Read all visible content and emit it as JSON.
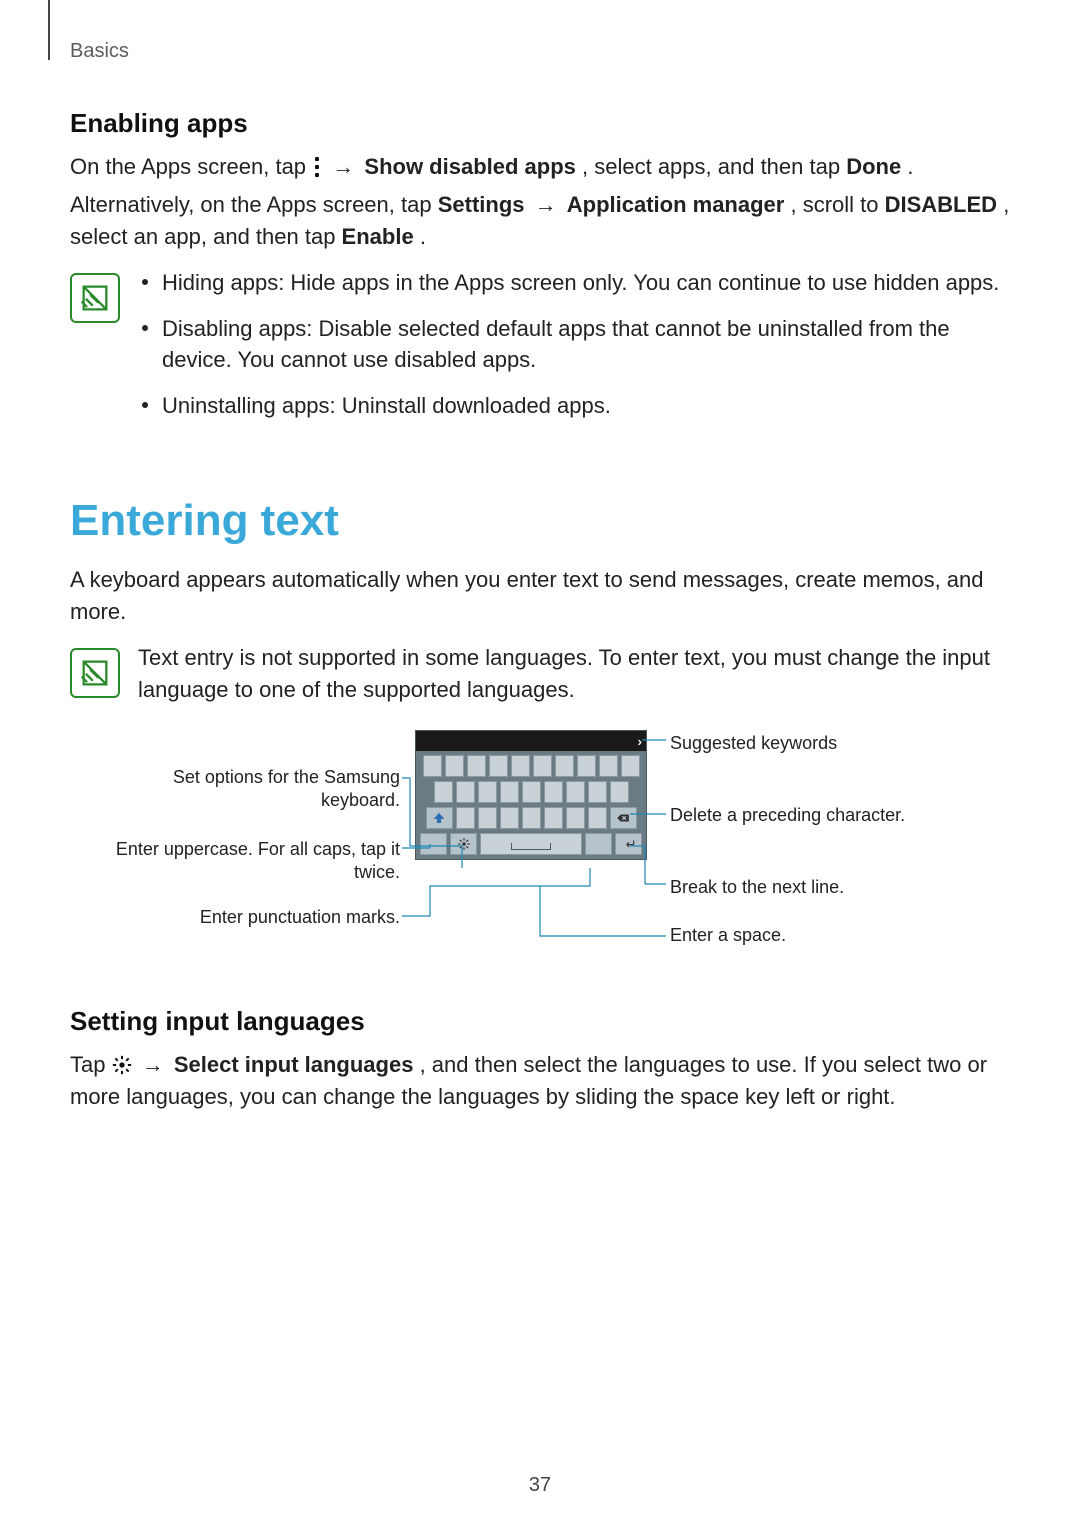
{
  "breadcrumb": "Basics",
  "page_number": "37",
  "sec_enabling": {
    "heading": "Enabling apps",
    "p1_a": "On the Apps screen, tap ",
    "p1_b": " → ",
    "p1_c": "Show disabled apps",
    "p1_d": ", select apps, and then tap ",
    "p1_e": "Done",
    "p1_f": ".",
    "p2_a": "Alternatively, on the Apps screen, tap ",
    "p2_b": "Settings",
    "p2_c": " → ",
    "p2_d": "Application manager",
    "p2_e": ", scroll to ",
    "p2_f": "DISABLED",
    "p2_g": ", select an app, and then tap ",
    "p2_h": "Enable",
    "p2_i": ".",
    "note_bullets": [
      "Hiding apps: Hide apps in the Apps screen only. You can continue to use hidden apps.",
      "Disabling apps: Disable selected default apps that cannot be uninstalled from the device. You cannot use disabled apps.",
      "Uninstalling apps: Uninstall downloaded apps."
    ]
  },
  "sec_entering": {
    "heading": "Entering text",
    "p1": "A keyboard appears automatically when you enter text to send messages, create memos, and more.",
    "note": "Text entry is not supported in some languages. To enter text, you must change the input language to one of the supported languages."
  },
  "diagram": {
    "suggested": "Suggested keywords",
    "set_options": "Set options for the Samsung keyboard.",
    "uppercase": "Enter uppercase. For all caps, tap it twice.",
    "punctuation": "Enter punctuation marks.",
    "delete": "Delete a preceding character.",
    "nextline": "Break to the next line.",
    "space": "Enter a space."
  },
  "sec_langs": {
    "heading": "Setting input languages",
    "p_a": "Tap ",
    "p_b": " → ",
    "p_c": "Select input languages",
    "p_d": ", and then select the languages to use. If you select two or more languages, you can change the languages by sliding the space key left or right."
  }
}
